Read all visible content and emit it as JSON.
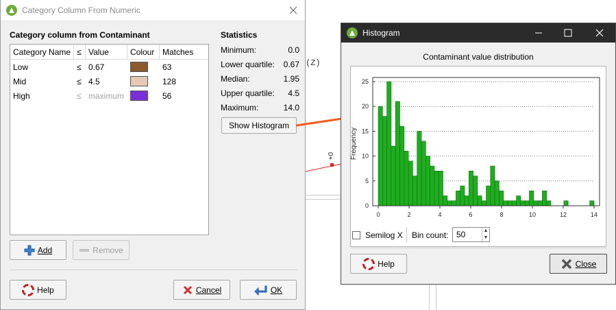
{
  "background": {
    "axis_label": "(Z)",
    "axis_tick": "+0"
  },
  "dialog1": {
    "title": "Category Column From Numeric",
    "section_title": "Category column from Contaminant",
    "table": {
      "headers": [
        "Category Name",
        "≤",
        "Value",
        "Colour",
        "Matches"
      ],
      "rows": [
        {
          "name": "Low",
          "op": "≤",
          "value": "0.67",
          "colour": "#8b5a2b",
          "matches": "63"
        },
        {
          "name": "Mid",
          "op": "≤",
          "value": "4.5",
          "colour": "#e6c8b4",
          "matches": "128"
        },
        {
          "name": "High",
          "op": "≤",
          "value": "maximum",
          "colour": "#7a2fd6",
          "matches": "56"
        }
      ]
    },
    "statistics": {
      "title": "Statistics",
      "rows": [
        {
          "label": "Minimum:",
          "value": "0.0"
        },
        {
          "label": "Lower quartile:",
          "value": "0.67"
        },
        {
          "label": "Median:",
          "value": "1.95"
        },
        {
          "label": "Upper quartile:",
          "value": "4.5"
        },
        {
          "label": "Maximum:",
          "value": "14.0"
        }
      ]
    },
    "buttons": {
      "show_histogram": "Show Histogram",
      "add": "Add",
      "remove": "Remove",
      "help": "Help",
      "cancel": "Cancel",
      "ok": "OK"
    }
  },
  "dialog2": {
    "title": "Histogram",
    "semilog_label": "Semilog X",
    "semilog_checked": false,
    "bin_count_label": "Bin count:",
    "bin_count_value": "50",
    "buttons": {
      "help": "Help",
      "close": "Close"
    }
  },
  "chart_data": {
    "type": "bar",
    "title": "Contaminant value distribution",
    "xlabel": "",
    "ylabel": "Frequency",
    "xlim": [
      0,
      14
    ],
    "ylim": [
      0,
      25
    ],
    "x_ticks": [
      "0",
      "2",
      "4",
      "6",
      "8",
      "10",
      "12",
      "14"
    ],
    "y_ticks": [
      "0",
      "5",
      "10",
      "15",
      "20",
      "25"
    ],
    "grid": "horizontal dotted",
    "bar_color": "#1fad1f",
    "bin_width": 0.28,
    "values": [
      20,
      18,
      25,
      12,
      21,
      16,
      11,
      9,
      6,
      15,
      13,
      10,
      8,
      7,
      7,
      2,
      1,
      1,
      3,
      4,
      2,
      7,
      6,
      2,
      1,
      4,
      8,
      5,
      3,
      1,
      1,
      1,
      2,
      1,
      1,
      3,
      1,
      1,
      3,
      1,
      0,
      0,
      0,
      1,
      0,
      0,
      0,
      0,
      0,
      1
    ]
  },
  "colors": {
    "accent_arrow": "#f25a1e",
    "app_icon": "#6cab3a",
    "bar": "#1fad1f"
  }
}
